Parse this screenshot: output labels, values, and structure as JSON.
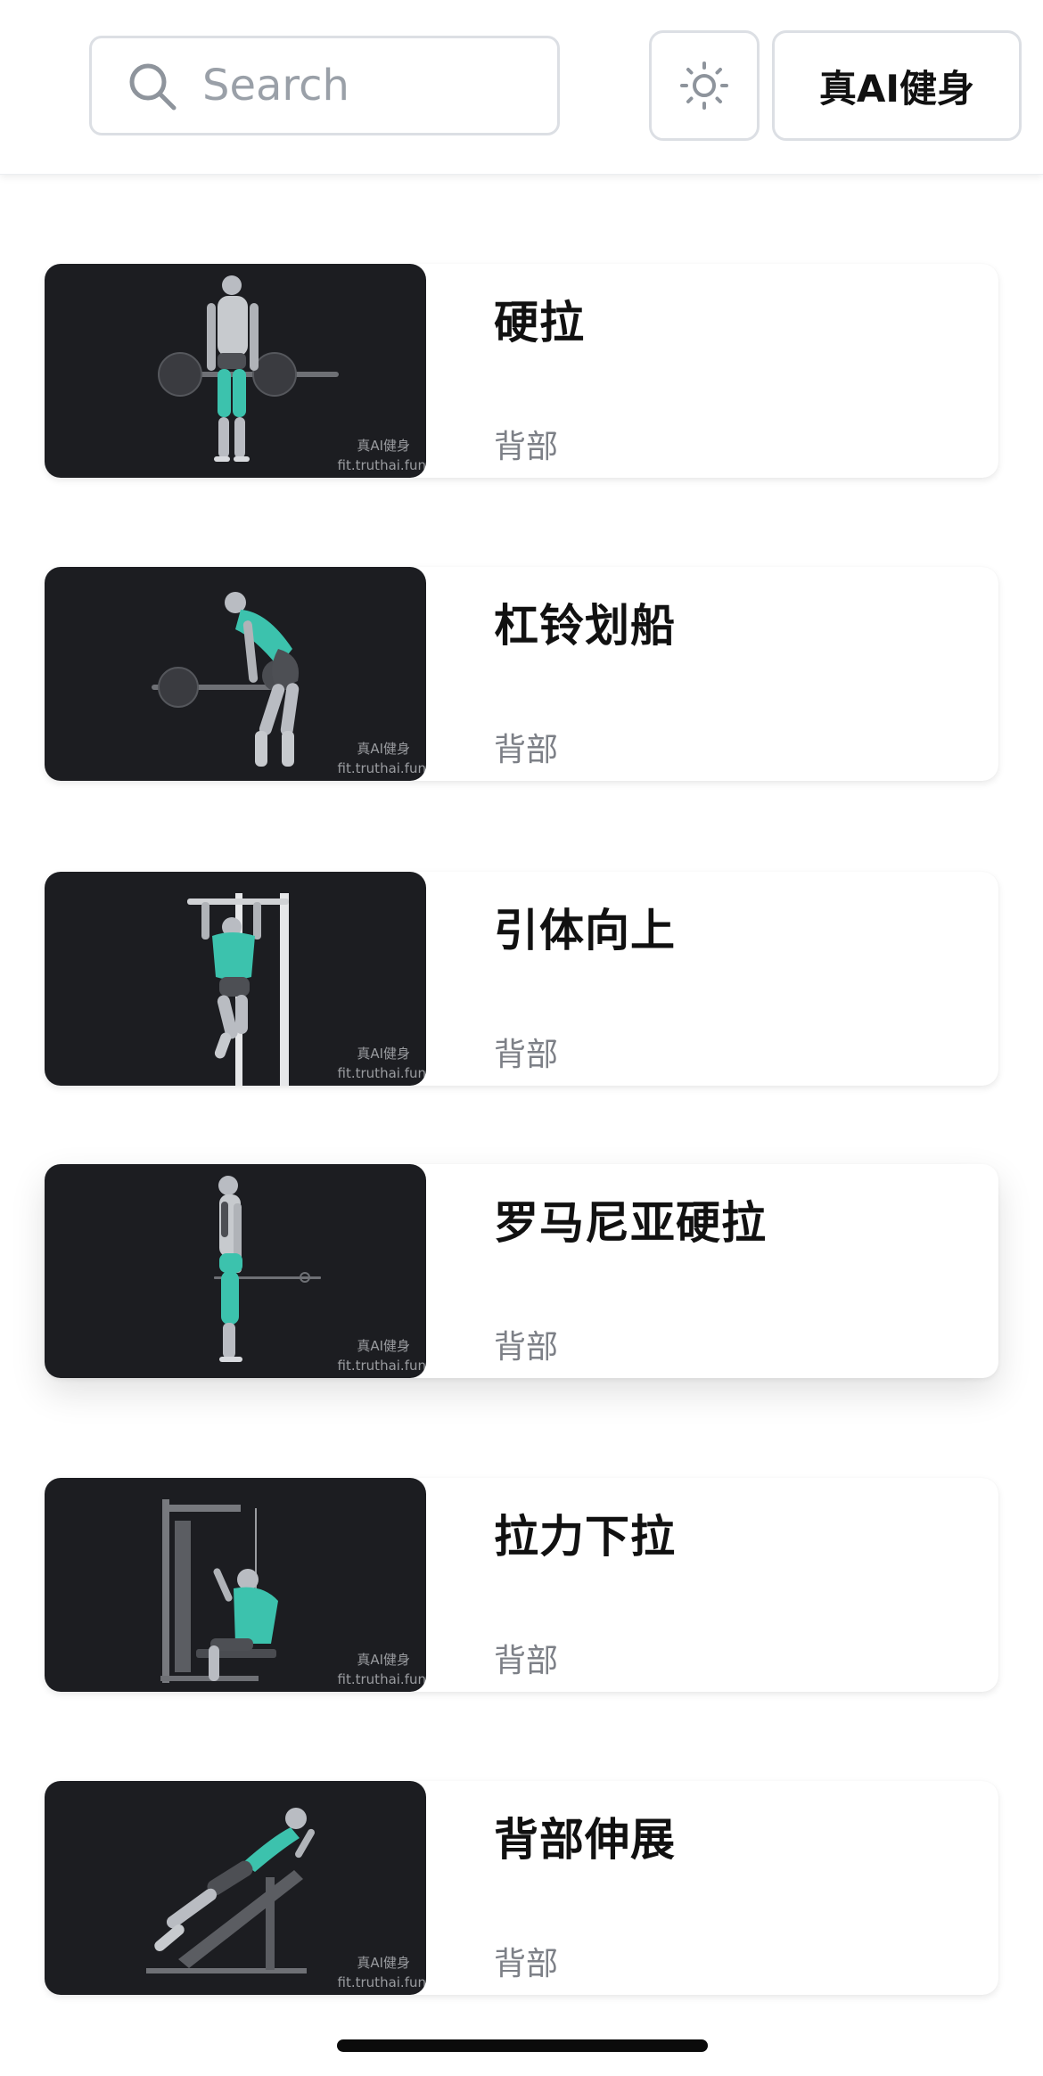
{
  "header": {
    "search": {
      "placeholder": "Search",
      "value": "",
      "icon": "search-icon"
    },
    "theme_toggle": {
      "icon": "sun-icon"
    },
    "brand_label": "真AI健身"
  },
  "exercises": [
    {
      "name": "硬拉",
      "category": "背部",
      "watermark_line1": "真AI健身",
      "watermark_line2": "fit.truthai.fun"
    },
    {
      "name": "杠铃划船",
      "category": "背部",
      "watermark_line1": "真AI健身",
      "watermark_line2": "fit.truthai.fun"
    },
    {
      "name": "引体向上",
      "category": "背部",
      "watermark_line1": "真AI健身",
      "watermark_line2": "fit.truthai.fun"
    },
    {
      "name": "罗马尼亚硬拉",
      "category": "背部",
      "watermark_line1": "真AI健身",
      "watermark_line2": "fit.truthai.fun"
    },
    {
      "name": "拉力下拉",
      "category": "背部",
      "watermark_line1": "真AI健身",
      "watermark_line2": "fit.truthai.fun"
    },
    {
      "name": "背部伸展",
      "category": "背部",
      "watermark_line1": "真AI健身",
      "watermark_line2": "fit.truthai.fun"
    }
  ],
  "colors": {
    "thumbnail_bg": "#1c1d21",
    "muscle_highlight": "#3cc2ad",
    "category_text": "#7d8087"
  }
}
